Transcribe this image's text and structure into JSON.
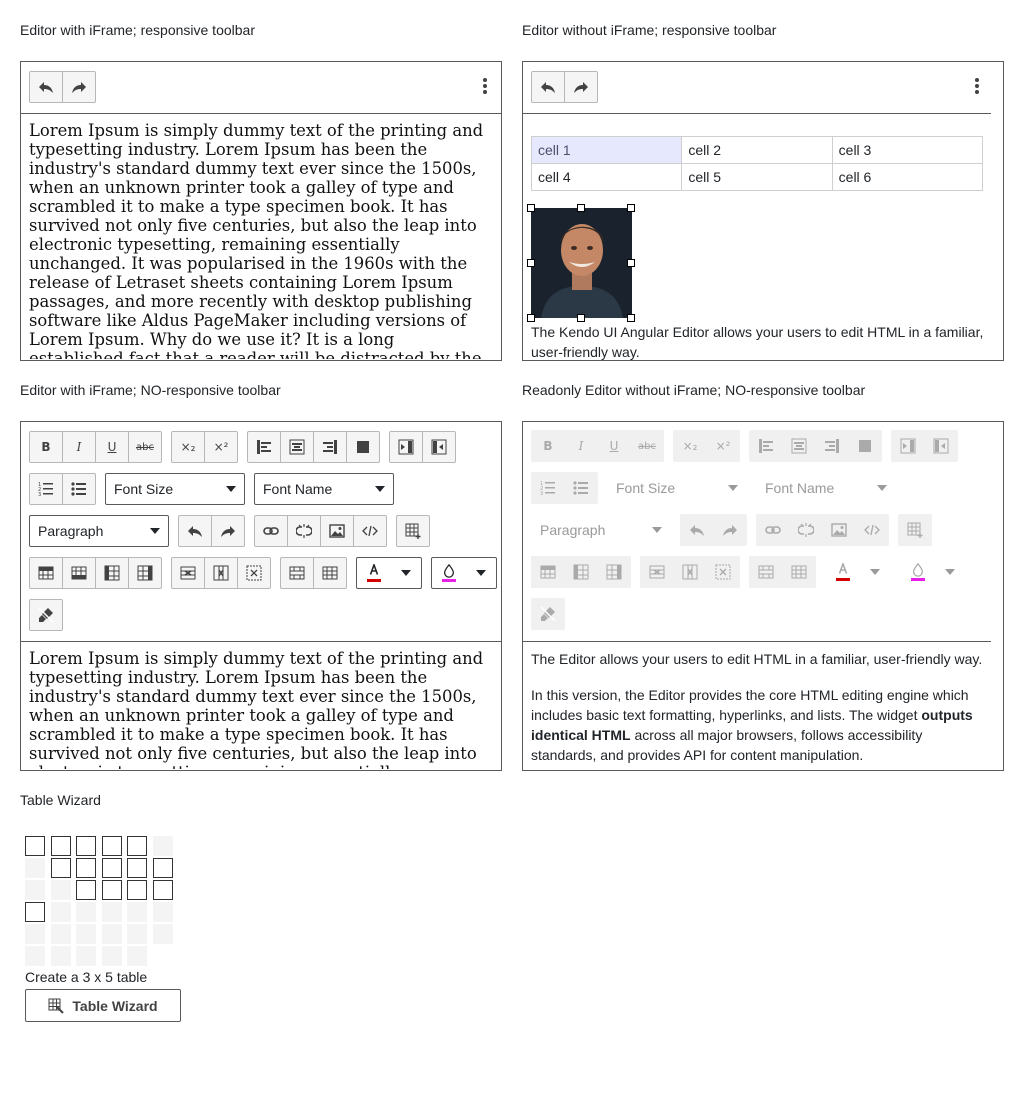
{
  "captions": {
    "editor1": "Editor with iFrame; responsive toolbar",
    "editor2": "Editor without iFrame; responsive toolbar",
    "editor3": "Editor with iFrame; NO-responsive toolbar",
    "editor4": "Readonly Editor without iFrame; NO-responsive toolbar",
    "wizard": "Table Wizard"
  },
  "lorem": "Lorem Ipsum is simply dummy text of the printing and typesetting industry. Lorem Ipsum has been the industry's standard dummy text ever since the 1500s, when an unknown printer took a galley of type and scrambled it to make a type specimen book. It has survived not only five centuries, but also the leap into electronic typesetting, remaining essentially unchanged. It was popularised in the 1960s with the release of Letraset sheets containing Lorem Ipsum passages, and more recently with desktop publishing software like Aldus PageMaker including versions of Lorem Ipsum. Why do we use it? It is a long established fact that a reader will be distracted by the readable content of a page when looking at its layout.",
  "editor2": {
    "table": [
      [
        "cell 1",
        "cell 2",
        "cell 3"
      ],
      [
        "cell 4",
        "cell 5",
        "cell 6"
      ]
    ],
    "caption_text": "The Kendo UI Angular Editor allows your users to edit HTML in a familiar, user-friendly way."
  },
  "toolbar": {
    "font_size_label": "Font Size",
    "font_name_label": "Font Name",
    "format_label": "Paragraph",
    "fore_color": "#d50000",
    "back_color": "#e91ee9"
  },
  "editor4": {
    "p1": "The Editor allows your users to edit HTML in a familiar, user-friendly way.",
    "p2_start": "In this version, the Editor provides the core HTML editing engine which includes basic text formatting, hyperlinks, and lists. The widget ",
    "p2_bold": "outputs identical HTML",
    "p2_end": " across all major browsers, follows accessibility standards, and provides API for content manipulation."
  },
  "wizard": {
    "rows": 3,
    "cols": 5,
    "create_text": "Create a 3 x 5 table",
    "button_label": "Table Wizard"
  }
}
